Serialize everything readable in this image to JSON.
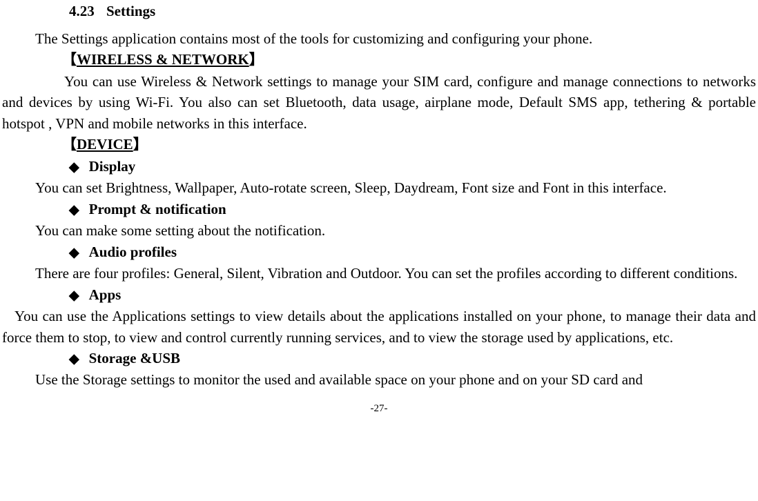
{
  "section": {
    "number": "4.23",
    "title": "Settings"
  },
  "intro": "The Settings application contains most of the tools for customizing and configuring your phone.",
  "wireless": {
    "heading": "WIRELESS & NETWORK",
    "body": "You can use Wireless & Network settings to manage your SIM card, configure and manage connections to networks and devices by using Wi-Fi. You also can set Bluetooth, data usage, airplane mode, Default SMS app, tethering & portable hotspot , VPN and mobile networks in this interface."
  },
  "device": {
    "heading": "DEVICE",
    "items": [
      {
        "label": "Display",
        "body": "You can set Brightness, Wallpaper, Auto-rotate screen, Sleep, Daydream, Font size and Font in this interface."
      },
      {
        "label": "Prompt & notification",
        "body": "You can make some setting about the notification."
      },
      {
        "label": "Audio profiles",
        "body": "There are four profiles: General, Silent, Vibration and Outdoor. You can set the profiles according to different conditions."
      },
      {
        "label": "Apps",
        "body": "You can use the Applications settings to view details about the applications installed on your phone, to manage their data and force them to stop, to view and control currently running services, and to view the storage used by applications, etc."
      },
      {
        "label": "Storage &USB",
        "body": "Use the Storage settings to monitor the used and available space on your phone and on your SD card and"
      }
    ]
  },
  "footer": "-27-",
  "glyphs": {
    "left_bracket": "【",
    "right_bracket": "】",
    "diamond": "◆"
  }
}
